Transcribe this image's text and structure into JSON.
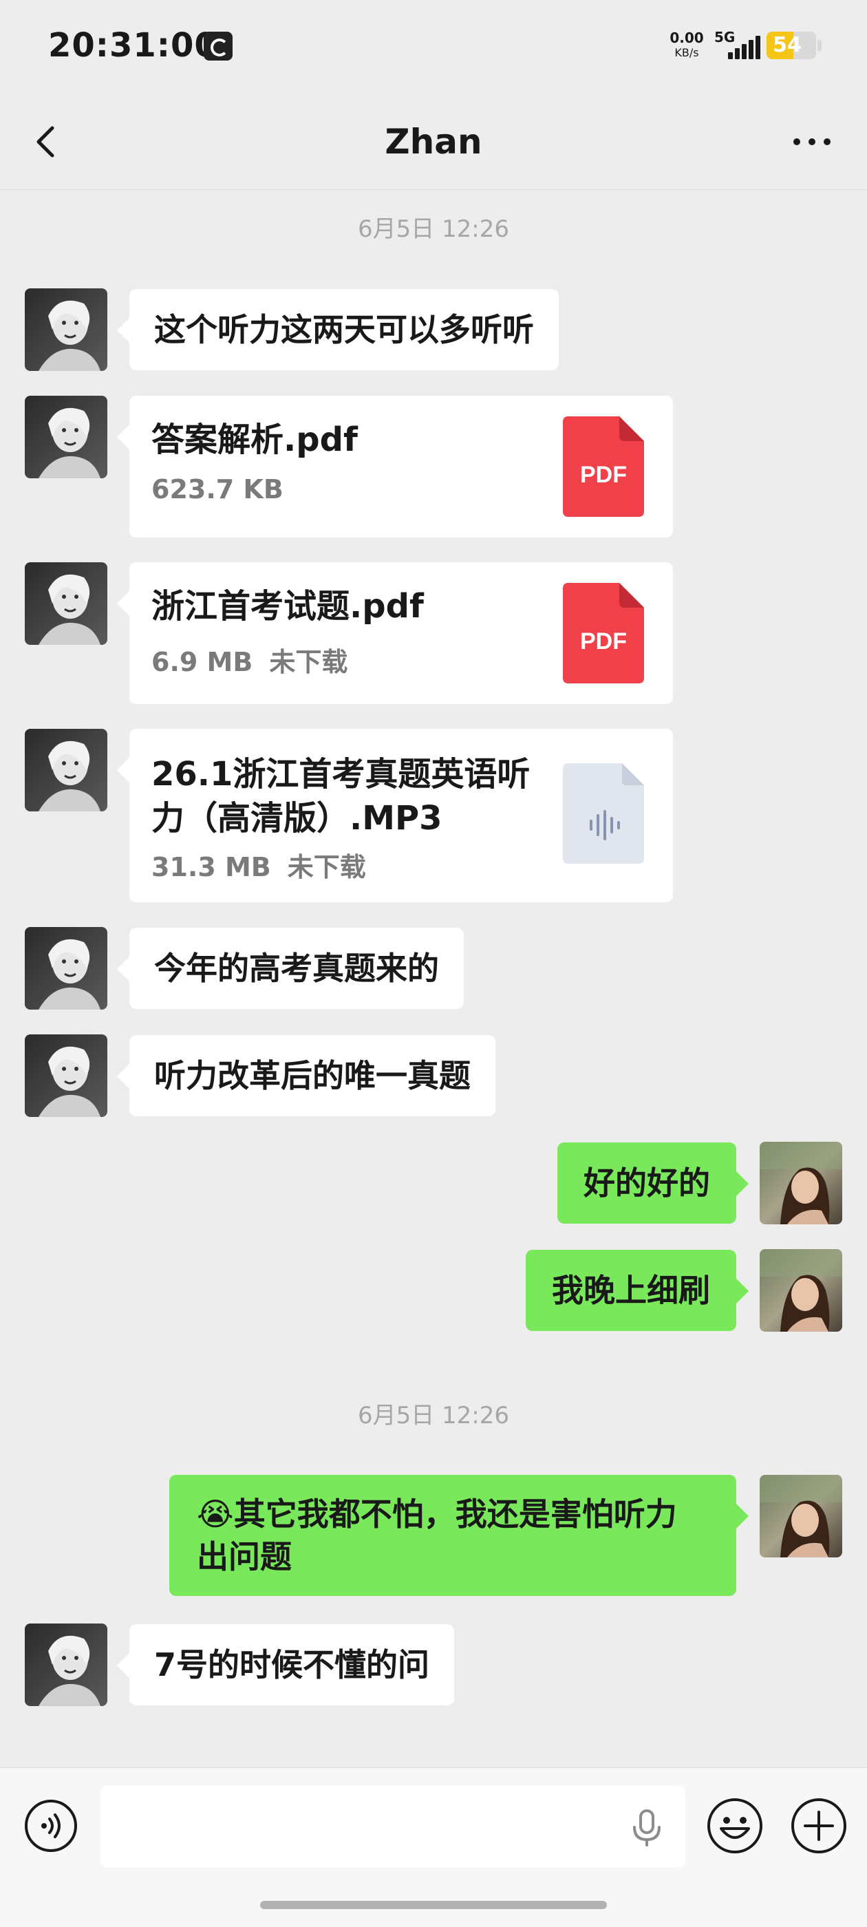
{
  "status_bar": {
    "time": "20:31:00",
    "net_speed": "0.00",
    "net_unit": "KB/s",
    "network": "5G",
    "battery": "54",
    "battery_level": 0.54
  },
  "header": {
    "title": "Zhan",
    "back_icon": "chevron-left-icon",
    "more_icon": "more-dots-icon"
  },
  "messages": {
    "time_1": "6月5日 12:26",
    "m1": "这个听力这两天可以多听听",
    "file1": {
      "name": "答案解析.pdf",
      "size": "623.7 KB",
      "status": "",
      "icon_label": "PDF"
    },
    "file2": {
      "name": "浙江首考试题.pdf",
      "size": "6.9 MB",
      "status": "未下载",
      "icon_label": "PDF"
    },
    "file3": {
      "name_line1": "26.1浙江首考真题英语听",
      "name_line2": "力（高清版）.MP3",
      "size": "31.3 MB",
      "status": "未下载"
    },
    "m2": "今年的高考真题来的",
    "m3": "听力改革后的唯一真题",
    "m4": "好的好的",
    "m5": "我晚上细刷",
    "time_2": "6月5日 12:26",
    "m6_line1": "😭其它我都不怕，我还是害怕听力",
    "m6_line2": "出问题",
    "m7": "7号的时候不懂的问"
  },
  "input_bar": {
    "text_value": "",
    "voice_icon": "voice-mode-icon",
    "mic_icon": "microphone-icon",
    "emoji_icon": "emoji-icon",
    "plus_icon": "plus-icon"
  },
  "colors": {
    "background": "#ededed",
    "outgoing_bubble": "#79e85b",
    "incoming_bubble": "#ffffff",
    "pdf_red": "#f0404a",
    "battery": "#f5c518"
  }
}
